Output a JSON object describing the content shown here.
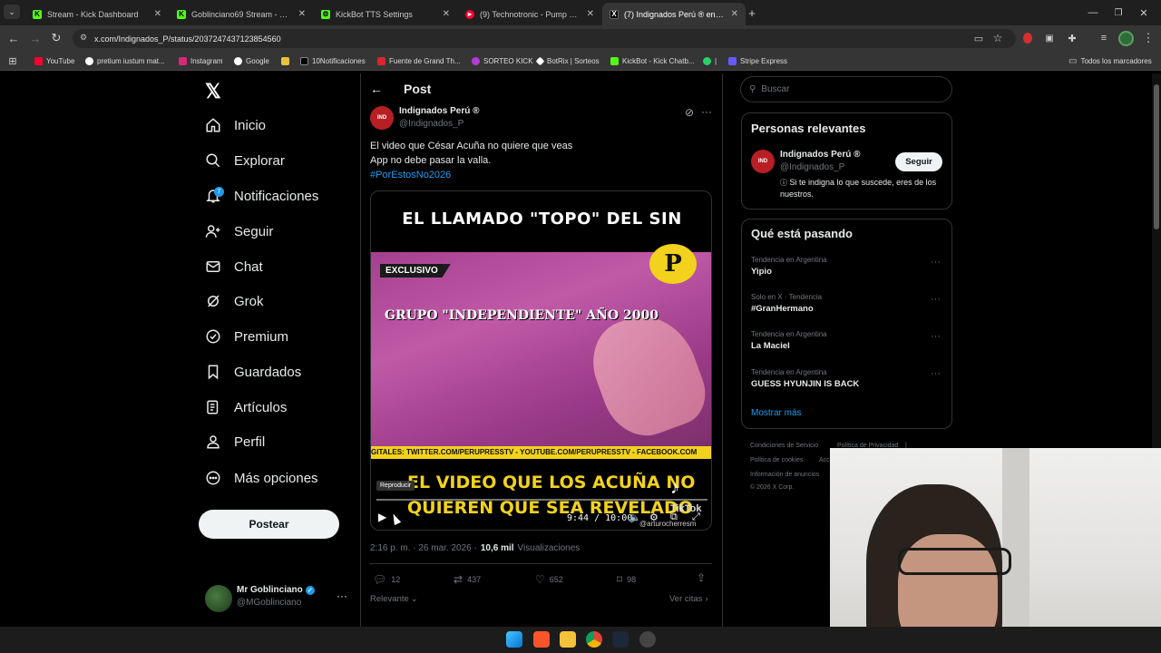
{
  "browser": {
    "tabs": [
      {
        "title": "Stream - Kick Dashboard",
        "icon": "kick-icon"
      },
      {
        "title": "Goblinciano69 Stream - Watch",
        "icon": "kick-icon"
      },
      {
        "title": "KickBot TTS Settings",
        "icon": "kickbot-icon"
      },
      {
        "title": "(9) Technotronic - Pump Up The",
        "icon": "youtube-icon"
      },
      {
        "title": "(7) Indignados Perú ® en X: \"El",
        "icon": "x-icon"
      }
    ],
    "url": "x.com/Indignados_P/status/2037247437123854560",
    "bookmarks": [
      "YouTube",
      "pretium iustum mat...",
      "Instagram",
      "Google",
      "10Notificaciones",
      "Fuente de Grand Th...",
      "SORTEO KICK",
      "BotRix | Sorteos",
      "KickBot - Kick Chatb...",
      "|",
      "Stripe Express"
    ],
    "bookmarks_all": "Todos los marcadores"
  },
  "nav": {
    "items": [
      "Inicio",
      "Explorar",
      "Notificaciones",
      "Seguir",
      "Chat",
      "Grok",
      "Premium",
      "Guardados",
      "Artículos",
      "Perfil",
      "Más opciones"
    ],
    "notif_badge": "7",
    "post_button": "Postear",
    "account": {
      "name": "Mr Goblinciano",
      "handle": "@MGoblinciano"
    }
  },
  "post": {
    "header": "Post",
    "author_name": "Indignados Perú ®",
    "author_handle": "@Indignados_P",
    "text_line1": "El video que César Acuña no quiere que veas",
    "text_line2": "App no debe pasar la valla.",
    "hashtag": "#PorEstosNo2026",
    "video": {
      "top_caption": "EL LLAMADO \"TOPO\" DEL SIN",
      "exclusivo": "EXCLUSIVO",
      "grupo": "GRUPO \"INDEPENDIENTE\" AÑO 2000",
      "social": "GITALES: TWITTER.COM/PERUPRESSTV - YOUTUBE.COM/PERUPRESSTV - FACEBOOK.COM",
      "bottom_line1": "EL VIDEO QUE LOS ACUÑA NO",
      "bottom_line2": "QUIEREN QUE SEA REVELADO",
      "logo": "P",
      "tooltip": "Reproducir",
      "time": "9:44 / 10:00",
      "tiktok": "TikTok",
      "tiktok_user": "@arturocherresm",
      "progress": 0.0
    },
    "meta_time": "2:16 p. m. · 26 mar. 2026 ·",
    "views_count": "10,6 mil",
    "views_label": "Visualizaciones",
    "stats": {
      "replies": "12",
      "reposts": "437",
      "likes": "652",
      "bookmarks": "98"
    },
    "relevance": "Relevante",
    "quotes": "Ver citas"
  },
  "sidebar": {
    "search_placeholder": "Buscar",
    "relevant_title": "Personas relevantes",
    "relevant": {
      "name": "Indignados Perú ®",
      "handle": "@Indignados_P",
      "follow": "Seguir",
      "bio": "Si te indigna lo que suscede, eres de los nuestros."
    },
    "trending_title": "Qué está pasando",
    "trends": [
      {
        "kicker": "Tendencia en Argentina",
        "name": "Yipio"
      },
      {
        "kicker": "Solo en X · Tendencia",
        "name": "#GranHermano"
      },
      {
        "kicker": "Tendencia en Argentina",
        "name": "La Maciel"
      },
      {
        "kicker": "Tendencia en Argentina",
        "name": "GUESS HYUNJIN IS BACK"
      }
    ],
    "show_more": "Mostrar más",
    "footer": [
      "Condiciones de Servicio",
      "Política de Privacidad",
      "|",
      "Política de cookies",
      "Acc",
      "Información de anuncios",
      "© 2026 X Corp."
    ]
  },
  "colors": {
    "accent": "#1d9bf0",
    "background": "#000000",
    "border": "#2f3336",
    "muted": "#71767b",
    "video_pink": "#c34a9c",
    "video_yellow": "#f2d21c"
  }
}
